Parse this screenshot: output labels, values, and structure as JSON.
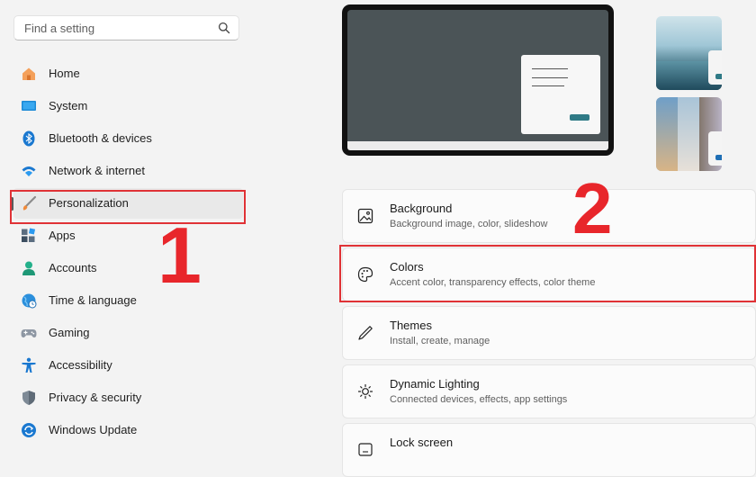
{
  "search": {
    "placeholder": "Find a setting",
    "icon": "search-icon"
  },
  "sidebar": {
    "items": [
      {
        "label": "Home",
        "icon": "home-icon"
      },
      {
        "label": "System",
        "icon": "system-icon"
      },
      {
        "label": "Bluetooth & devices",
        "icon": "bluetooth-icon"
      },
      {
        "label": "Network & internet",
        "icon": "wifi-icon"
      },
      {
        "label": "Personalization",
        "icon": "brush-icon",
        "active": true
      },
      {
        "label": "Apps",
        "icon": "apps-icon"
      },
      {
        "label": "Accounts",
        "icon": "account-icon"
      },
      {
        "label": "Time & language",
        "icon": "globe-clock-icon"
      },
      {
        "label": "Gaming",
        "icon": "gamepad-icon"
      },
      {
        "label": "Accessibility",
        "icon": "accessibility-icon"
      },
      {
        "label": "Privacy & security",
        "icon": "shield-icon"
      },
      {
        "label": "Windows Update",
        "icon": "update-icon"
      }
    ]
  },
  "annotations": {
    "step1": "1",
    "step2": "2",
    "highlight_color": "#e03236"
  },
  "cards": [
    {
      "title": "Background",
      "subtitle": "Background image, color, slideshow",
      "icon": "picture-icon"
    },
    {
      "title": "Colors",
      "subtitle": "Accent color, transparency effects, color theme",
      "icon": "palette-icon"
    },
    {
      "title": "Themes",
      "subtitle": "Install, create, manage",
      "icon": "pen-icon"
    },
    {
      "title": "Dynamic Lighting",
      "subtitle": "Connected devices, effects, app settings",
      "icon": "lighting-icon"
    },
    {
      "title": "Lock screen",
      "subtitle": "",
      "icon": "lockscreen-icon"
    }
  ],
  "colors": {
    "accent": "#2f7a86",
    "preview_bg": "#4b5457",
    "sidebar_bg": "#f3f3f3"
  }
}
